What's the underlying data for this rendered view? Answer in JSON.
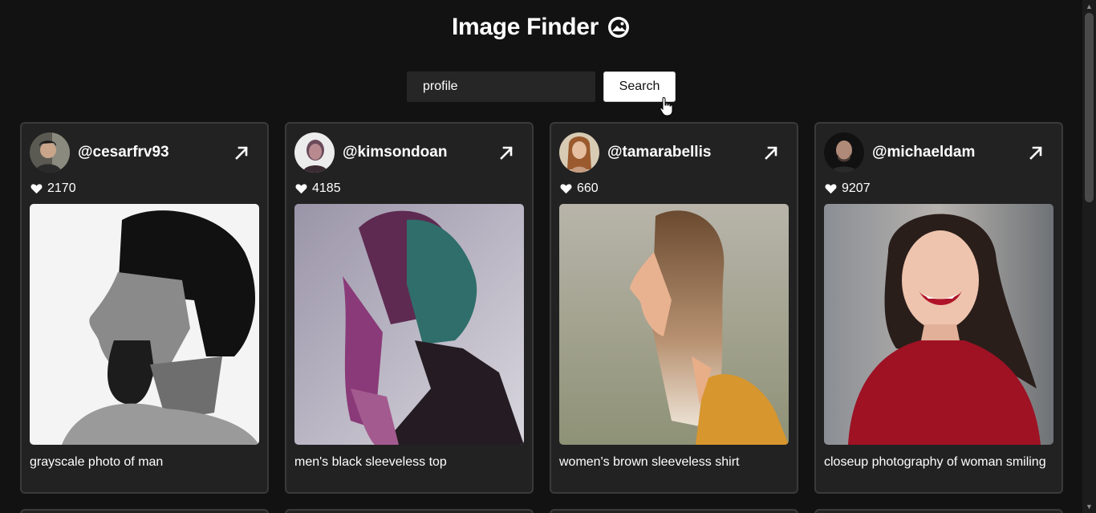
{
  "app": {
    "title": "Image Finder"
  },
  "search": {
    "query": "profile",
    "button_label": "Search"
  },
  "cards": [
    {
      "username": "@cesarfrv93",
      "likes": "2170",
      "caption": "grayscale photo of man"
    },
    {
      "username": "@kimsondoan",
      "likes": "4185",
      "caption": "men's black sleeveless top"
    },
    {
      "username": "@tamarabellis",
      "likes": "660",
      "caption": "women's brown sleeveless shirt"
    },
    {
      "username": "@michaeldam",
      "likes": "9207",
      "caption": "closeup photography of woman smiling"
    }
  ],
  "icons": {
    "title": "image-icon",
    "open_link": "arrow-up-right-icon",
    "likes": "heart-icon"
  },
  "colors": {
    "background": "#121212",
    "card": "#222222",
    "card_border": "#3a3a3a"
  }
}
